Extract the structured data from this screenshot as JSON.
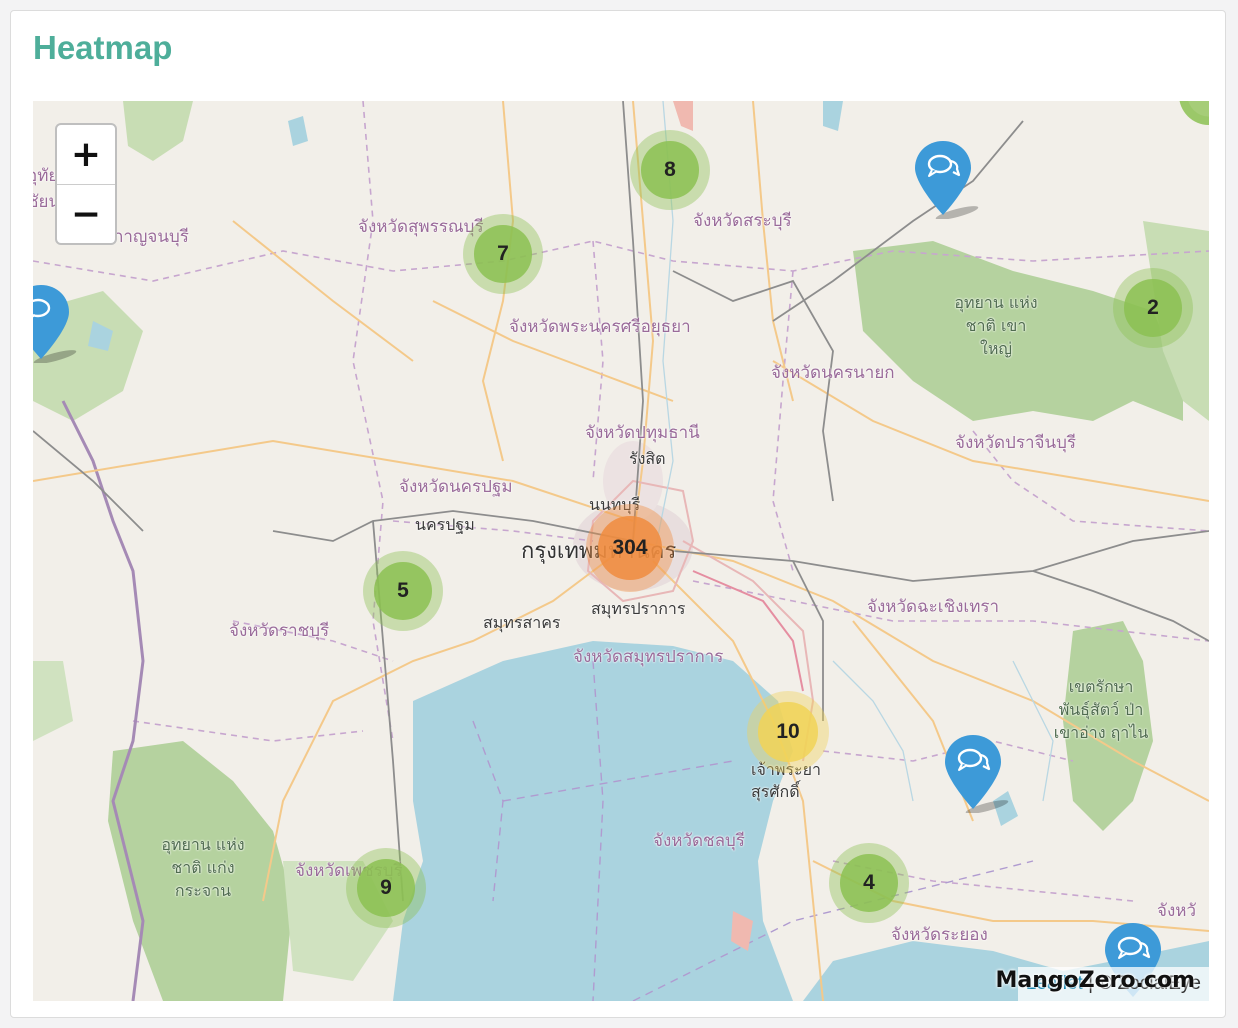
{
  "panel": {
    "title": "Heatmap"
  },
  "map": {
    "zoom_in_label": "+",
    "zoom_out_label": "−",
    "attribution": {
      "leaflet": "Leaflet",
      "separator": " | © ",
      "owner": "ZocialEye"
    },
    "watermark": "MangoZero.com",
    "labels": {
      "suphanburi": "จังหวัดสุพรรณบุรี",
      "saraburi": "จังหวัดสระบุรี",
      "ayutthaya": "จังหวัดพระนครศรีอยุธยา",
      "nakhon_nayok": "จังหวัดนครนายก",
      "pathum_thani": "จังหวัดปทุมธานี",
      "rangsit": "รังสิต",
      "nakhon_pathom_prov": "จังหวัดนครปฐม",
      "nakhon_pathom": "นครปฐม",
      "nonthaburi": "นนทบุรี",
      "bangkok": "กรุงเทพมหานคร",
      "samut_prakan": "สมุทรปราการ",
      "samut_sakhon": "สมุทรสาคร",
      "samut_prakan_prov": "จังหวัดสมุทรปราการ",
      "ratchaburi": "จังหวัดราชบุรี",
      "chachoengsao": "จังหวัดฉะเชิงเทรา",
      "prachinburi": "จังหวัดปราจีนบุรี",
      "chaophraya_surasak": "เจ้าพระยา สุรศักดิ์",
      "chonburi": "จังหวัดชลบุรี",
      "rayong": "จังหวัดระยอง",
      "phetchaburi": "จังหวัดเพชรบุรี",
      "kanchanaburi": "จังหวัดกาญจนบุรี",
      "khao_yai": "อุทยาน แห่งชาติ เขาใหญ่",
      "kaeng_krachan": "อุทยาน แห่งชาติ แก่งกระจาน",
      "wildlife_sanctuary": "เขตรักษา พันธุ์สัตว์ ป่าเขาอ่าง ฤาไน",
      "chanthaburi_partial": "จังหวั",
      "edge_label": "อุทัยธานี ชัยนาท"
    },
    "clusters": [
      {
        "count": "8",
        "level": "small"
      },
      {
        "count": "7",
        "level": "small"
      },
      {
        "count": "2",
        "level": "small"
      },
      {
        "count": "304",
        "level": "large"
      },
      {
        "count": "5",
        "level": "small"
      },
      {
        "count": "10",
        "level": "medium"
      },
      {
        "count": "9",
        "level": "small"
      },
      {
        "count": "4",
        "level": "small"
      }
    ],
    "colors": {
      "small": "#8cc152",
      "medium": "#f1d357",
      "large": "#f08c3e",
      "marker": "#3d9ad8",
      "water": "#aad3df",
      "park": "#c8ddb4"
    }
  }
}
